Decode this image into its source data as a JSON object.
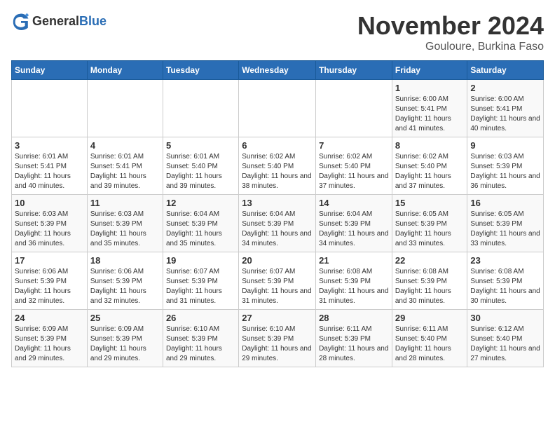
{
  "logo": {
    "general": "General",
    "blue": "Blue"
  },
  "header": {
    "month": "November 2024",
    "location": "Gouloure, Burkina Faso"
  },
  "days_of_week": [
    "Sunday",
    "Monday",
    "Tuesday",
    "Wednesday",
    "Thursday",
    "Friday",
    "Saturday"
  ],
  "weeks": [
    [
      {
        "day": "",
        "info": ""
      },
      {
        "day": "",
        "info": ""
      },
      {
        "day": "",
        "info": ""
      },
      {
        "day": "",
        "info": ""
      },
      {
        "day": "",
        "info": ""
      },
      {
        "day": "1",
        "info": "Sunrise: 6:00 AM\nSunset: 5:41 PM\nDaylight: 11 hours and 41 minutes."
      },
      {
        "day": "2",
        "info": "Sunrise: 6:00 AM\nSunset: 5:41 PM\nDaylight: 11 hours and 40 minutes."
      }
    ],
    [
      {
        "day": "3",
        "info": "Sunrise: 6:01 AM\nSunset: 5:41 PM\nDaylight: 11 hours and 40 minutes."
      },
      {
        "day": "4",
        "info": "Sunrise: 6:01 AM\nSunset: 5:41 PM\nDaylight: 11 hours and 39 minutes."
      },
      {
        "day": "5",
        "info": "Sunrise: 6:01 AM\nSunset: 5:40 PM\nDaylight: 11 hours and 39 minutes."
      },
      {
        "day": "6",
        "info": "Sunrise: 6:02 AM\nSunset: 5:40 PM\nDaylight: 11 hours and 38 minutes."
      },
      {
        "day": "7",
        "info": "Sunrise: 6:02 AM\nSunset: 5:40 PM\nDaylight: 11 hours and 37 minutes."
      },
      {
        "day": "8",
        "info": "Sunrise: 6:02 AM\nSunset: 5:40 PM\nDaylight: 11 hours and 37 minutes."
      },
      {
        "day": "9",
        "info": "Sunrise: 6:03 AM\nSunset: 5:39 PM\nDaylight: 11 hours and 36 minutes."
      }
    ],
    [
      {
        "day": "10",
        "info": "Sunrise: 6:03 AM\nSunset: 5:39 PM\nDaylight: 11 hours and 36 minutes."
      },
      {
        "day": "11",
        "info": "Sunrise: 6:03 AM\nSunset: 5:39 PM\nDaylight: 11 hours and 35 minutes."
      },
      {
        "day": "12",
        "info": "Sunrise: 6:04 AM\nSunset: 5:39 PM\nDaylight: 11 hours and 35 minutes."
      },
      {
        "day": "13",
        "info": "Sunrise: 6:04 AM\nSunset: 5:39 PM\nDaylight: 11 hours and 34 minutes."
      },
      {
        "day": "14",
        "info": "Sunrise: 6:04 AM\nSunset: 5:39 PM\nDaylight: 11 hours and 34 minutes."
      },
      {
        "day": "15",
        "info": "Sunrise: 6:05 AM\nSunset: 5:39 PM\nDaylight: 11 hours and 33 minutes."
      },
      {
        "day": "16",
        "info": "Sunrise: 6:05 AM\nSunset: 5:39 PM\nDaylight: 11 hours and 33 minutes."
      }
    ],
    [
      {
        "day": "17",
        "info": "Sunrise: 6:06 AM\nSunset: 5:39 PM\nDaylight: 11 hours and 32 minutes."
      },
      {
        "day": "18",
        "info": "Sunrise: 6:06 AM\nSunset: 5:39 PM\nDaylight: 11 hours and 32 minutes."
      },
      {
        "day": "19",
        "info": "Sunrise: 6:07 AM\nSunset: 5:39 PM\nDaylight: 11 hours and 31 minutes."
      },
      {
        "day": "20",
        "info": "Sunrise: 6:07 AM\nSunset: 5:39 PM\nDaylight: 11 hours and 31 minutes."
      },
      {
        "day": "21",
        "info": "Sunrise: 6:08 AM\nSunset: 5:39 PM\nDaylight: 11 hours and 31 minutes."
      },
      {
        "day": "22",
        "info": "Sunrise: 6:08 AM\nSunset: 5:39 PM\nDaylight: 11 hours and 30 minutes."
      },
      {
        "day": "23",
        "info": "Sunrise: 6:08 AM\nSunset: 5:39 PM\nDaylight: 11 hours and 30 minutes."
      }
    ],
    [
      {
        "day": "24",
        "info": "Sunrise: 6:09 AM\nSunset: 5:39 PM\nDaylight: 11 hours and 29 minutes."
      },
      {
        "day": "25",
        "info": "Sunrise: 6:09 AM\nSunset: 5:39 PM\nDaylight: 11 hours and 29 minutes."
      },
      {
        "day": "26",
        "info": "Sunrise: 6:10 AM\nSunset: 5:39 PM\nDaylight: 11 hours and 29 minutes."
      },
      {
        "day": "27",
        "info": "Sunrise: 6:10 AM\nSunset: 5:39 PM\nDaylight: 11 hours and 29 minutes."
      },
      {
        "day": "28",
        "info": "Sunrise: 6:11 AM\nSunset: 5:39 PM\nDaylight: 11 hours and 28 minutes."
      },
      {
        "day": "29",
        "info": "Sunrise: 6:11 AM\nSunset: 5:40 PM\nDaylight: 11 hours and 28 minutes."
      },
      {
        "day": "30",
        "info": "Sunrise: 6:12 AM\nSunset: 5:40 PM\nDaylight: 11 hours and 27 minutes."
      }
    ]
  ]
}
